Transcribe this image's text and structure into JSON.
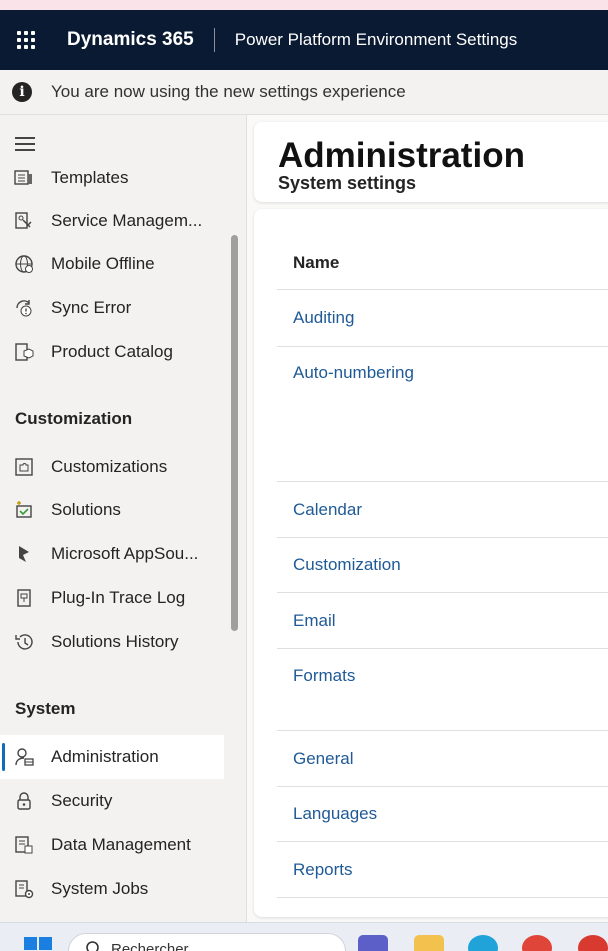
{
  "header": {
    "brand": "Dynamics 365",
    "subtitle": "Power Platform Environment Settings"
  },
  "infobar": {
    "icon": "info-icon",
    "message": "You are now using the new settings experience"
  },
  "sidebar": {
    "items": [
      {
        "label": "Templates",
        "icon": "templates-icon"
      },
      {
        "label": "Service Managem...",
        "icon": "service-management-icon"
      },
      {
        "label": "Mobile Offline",
        "icon": "globe-icon"
      },
      {
        "label": "Sync Error",
        "icon": "sync-error-icon"
      },
      {
        "label": "Product Catalog",
        "icon": "product-catalog-icon"
      }
    ],
    "customization": {
      "title": "Customization",
      "items": [
        {
          "label": "Customizations",
          "icon": "puzzle-icon"
        },
        {
          "label": "Solutions",
          "icon": "solutions-icon"
        },
        {
          "label": "Microsoft AppSou...",
          "icon": "appsource-icon"
        },
        {
          "label": "Plug-In Trace Log",
          "icon": "trace-log-icon"
        },
        {
          "label": "Solutions History",
          "icon": "history-icon"
        }
      ]
    },
    "system": {
      "title": "System",
      "items": [
        {
          "label": "Administration",
          "icon": "administration-icon",
          "active": true
        },
        {
          "label": "Security",
          "icon": "lock-icon"
        },
        {
          "label": "Data Management",
          "icon": "data-management-icon"
        },
        {
          "label": "System Jobs",
          "icon": "system-jobs-icon"
        }
      ]
    }
  },
  "main": {
    "title": "Administration",
    "subtitle": "System settings",
    "column_header": "Name",
    "rows": [
      "Auditing",
      "Auto-numbering",
      "Calendar",
      "Customization",
      "Email",
      "Formats",
      "General",
      "Languages",
      "Reports"
    ]
  },
  "taskbar": {
    "search_placeholder": "Rechercher"
  },
  "colors": {
    "header_bg": "#0b1a33",
    "link": "#1f5a96",
    "active_indicator": "#0f6cbd"
  }
}
